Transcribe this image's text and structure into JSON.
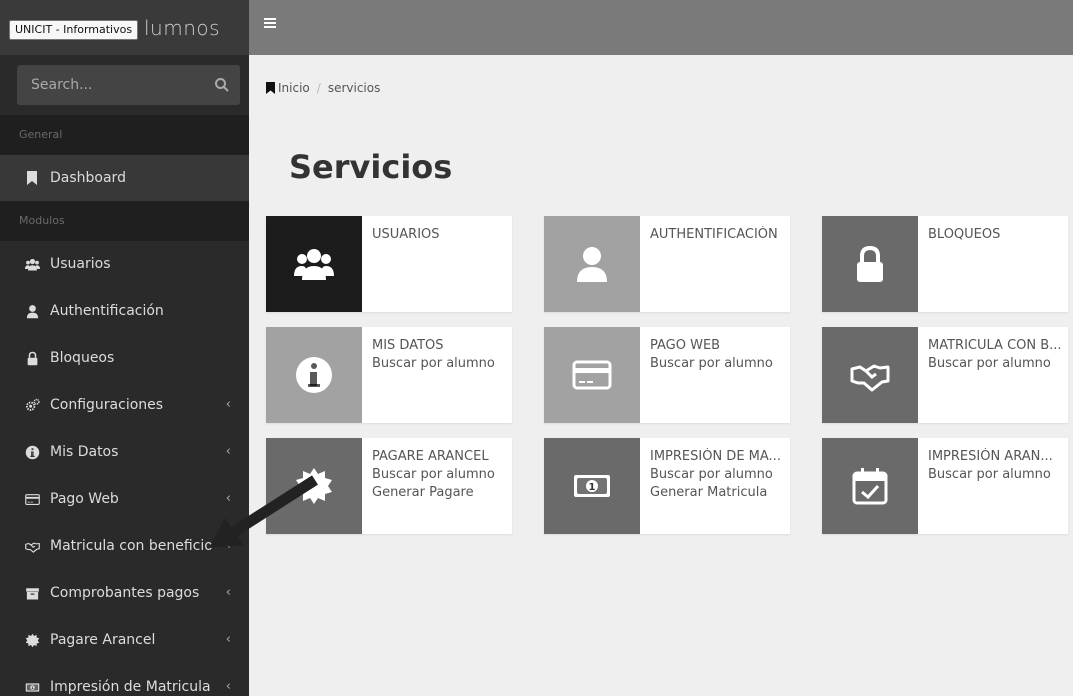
{
  "tooltip": "UNICIT - Informativos",
  "brand": "lumnos",
  "search": {
    "placeholder": "Search..."
  },
  "sidebar": {
    "general_header": "General",
    "modulos_header": "Modulos",
    "dashboard": "Dashboard",
    "items": [
      {
        "label": "Usuarios",
        "icon": "users-icon",
        "chevron": false
      },
      {
        "label": "Authentificación",
        "icon": "user-icon",
        "chevron": false
      },
      {
        "label": "Bloqueos",
        "icon": "lock-icon",
        "chevron": false
      },
      {
        "label": "Configuraciones",
        "icon": "cogs-icon",
        "chevron": true
      },
      {
        "label": "Mis Datos",
        "icon": "info-icon",
        "chevron": true
      },
      {
        "label": "Pago Web",
        "icon": "credit-card-icon",
        "chevron": true
      },
      {
        "label": "Matricula con beneficio",
        "icon": "handshake-icon",
        "chevron": true
      },
      {
        "label": "Comprobantes pagos",
        "icon": "archive-icon",
        "chevron": true
      },
      {
        "label": "Pagare Arancel",
        "icon": "certificate-icon",
        "chevron": true
      },
      {
        "label": "Impresión de Matricula",
        "icon": "money-icon",
        "chevron": true
      }
    ],
    "chevron_glyph": "‹"
  },
  "breadcrumb": {
    "home": "Inicio",
    "separator": "/",
    "current": "servicios"
  },
  "page_title": "Servicios",
  "tiles": [
    {
      "title": "USUARIOS",
      "lines": [],
      "icon": "users-icon",
      "color": "#1c1c1c"
    },
    {
      "title": "AUTHENTIFICACIÓN",
      "lines": [],
      "icon": "user-icon",
      "color": "#a2a2a2"
    },
    {
      "title": "BLOQUEOS",
      "lines": [],
      "icon": "lock-icon",
      "color": "#6a6a6a"
    },
    {
      "title": "MIS DATOS",
      "lines": [
        "Buscar por alumno"
      ],
      "icon": "info-icon",
      "color": "#a2a2a2"
    },
    {
      "title": "PAGO WEB",
      "lines": [
        "Buscar por alumno"
      ],
      "icon": "credit-card-icon",
      "color": "#a2a2a2"
    },
    {
      "title": "MATRICULA CON B...",
      "lines": [
        "Buscar por alumno"
      ],
      "icon": "handshake-icon",
      "color": "#6a6a6a"
    },
    {
      "title": "PAGARE ARANCEL",
      "lines": [
        "Buscar por alumno",
        "Generar Pagare"
      ],
      "icon": "certificate-icon",
      "color": "#6a6a6a"
    },
    {
      "title": "IMPRESIÓN DE MA...",
      "lines": [
        "Buscar por alumno",
        "Generar Matricula"
      ],
      "icon": "money-icon",
      "color": "#6a6a6a"
    },
    {
      "title": "IMPRESIÓN ARAN...",
      "lines": [
        "Buscar por alumno"
      ],
      "icon": "calendar-check-icon",
      "color": "#6a6a6a"
    }
  ],
  "colors": {
    "sidebar_bg": "#2a2a2a",
    "topbar_bg": "#7a7a7a",
    "page_bg": "#efefef"
  }
}
